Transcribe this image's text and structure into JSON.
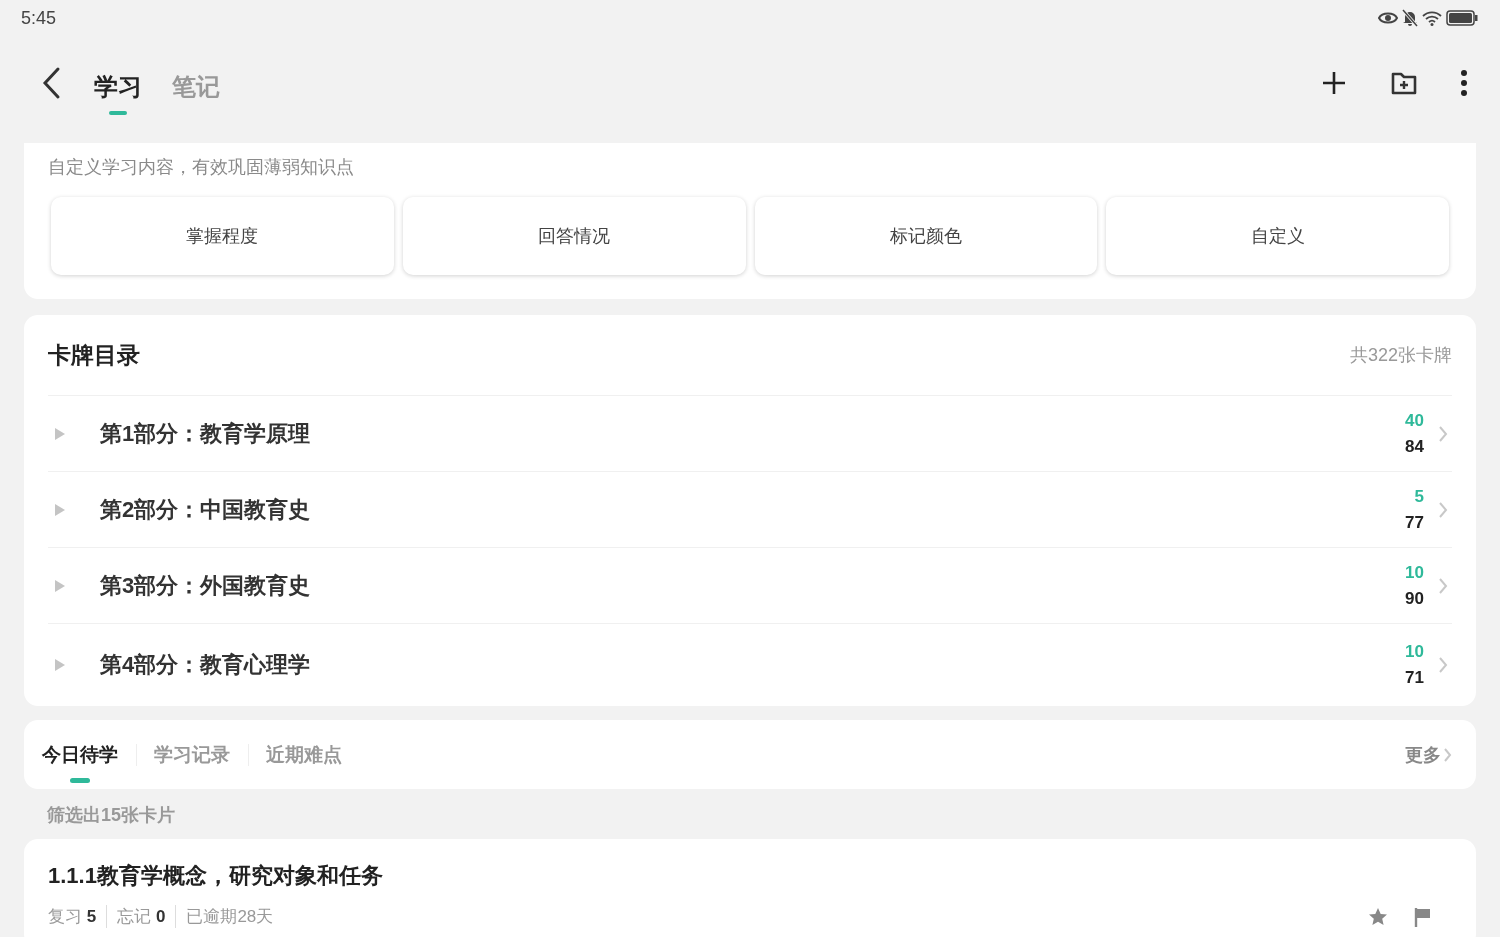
{
  "status_bar": {
    "time": "5:45"
  },
  "header_tabs": [
    {
      "label": "学习",
      "selected": true
    },
    {
      "label": "笔记",
      "selected": false
    }
  ],
  "filter_panel": {
    "description": "自定义学习内容，有效巩固薄弱知识点",
    "options": [
      "掌握程度",
      "回答情况",
      "标记颜色",
      "自定义"
    ]
  },
  "deck_catalog": {
    "title": "卡牌目录",
    "total": "共322张卡牌",
    "sections": [
      {
        "title": "第1部分：教育学原理",
        "expanded": false,
        "due": "40",
        "count": "84"
      },
      {
        "title": "第2部分：中国教育史",
        "expanded": false,
        "due": "5",
        "count": "77"
      },
      {
        "title": "第3部分：外国教育史",
        "expanded": false,
        "due": "10",
        "count": "90"
      },
      {
        "title": "第4部分：教育心理学",
        "expanded": false,
        "due": "10",
        "count": "71"
      }
    ]
  },
  "study_tabs": {
    "tabs": [
      {
        "label": "今日待学",
        "selected": true
      },
      {
        "label": "学习记录",
        "selected": false
      },
      {
        "label": "近期难点",
        "selected": false
      }
    ],
    "more": "更多"
  },
  "filter_result": "筛选出15张卡片",
  "cards": [
    {
      "title": "1.1.1教育学概念，研究对象和任务",
      "meta": [
        "复习 **5**",
        "忘记 **0**",
        "已逾期28天"
      ]
    }
  ]
}
